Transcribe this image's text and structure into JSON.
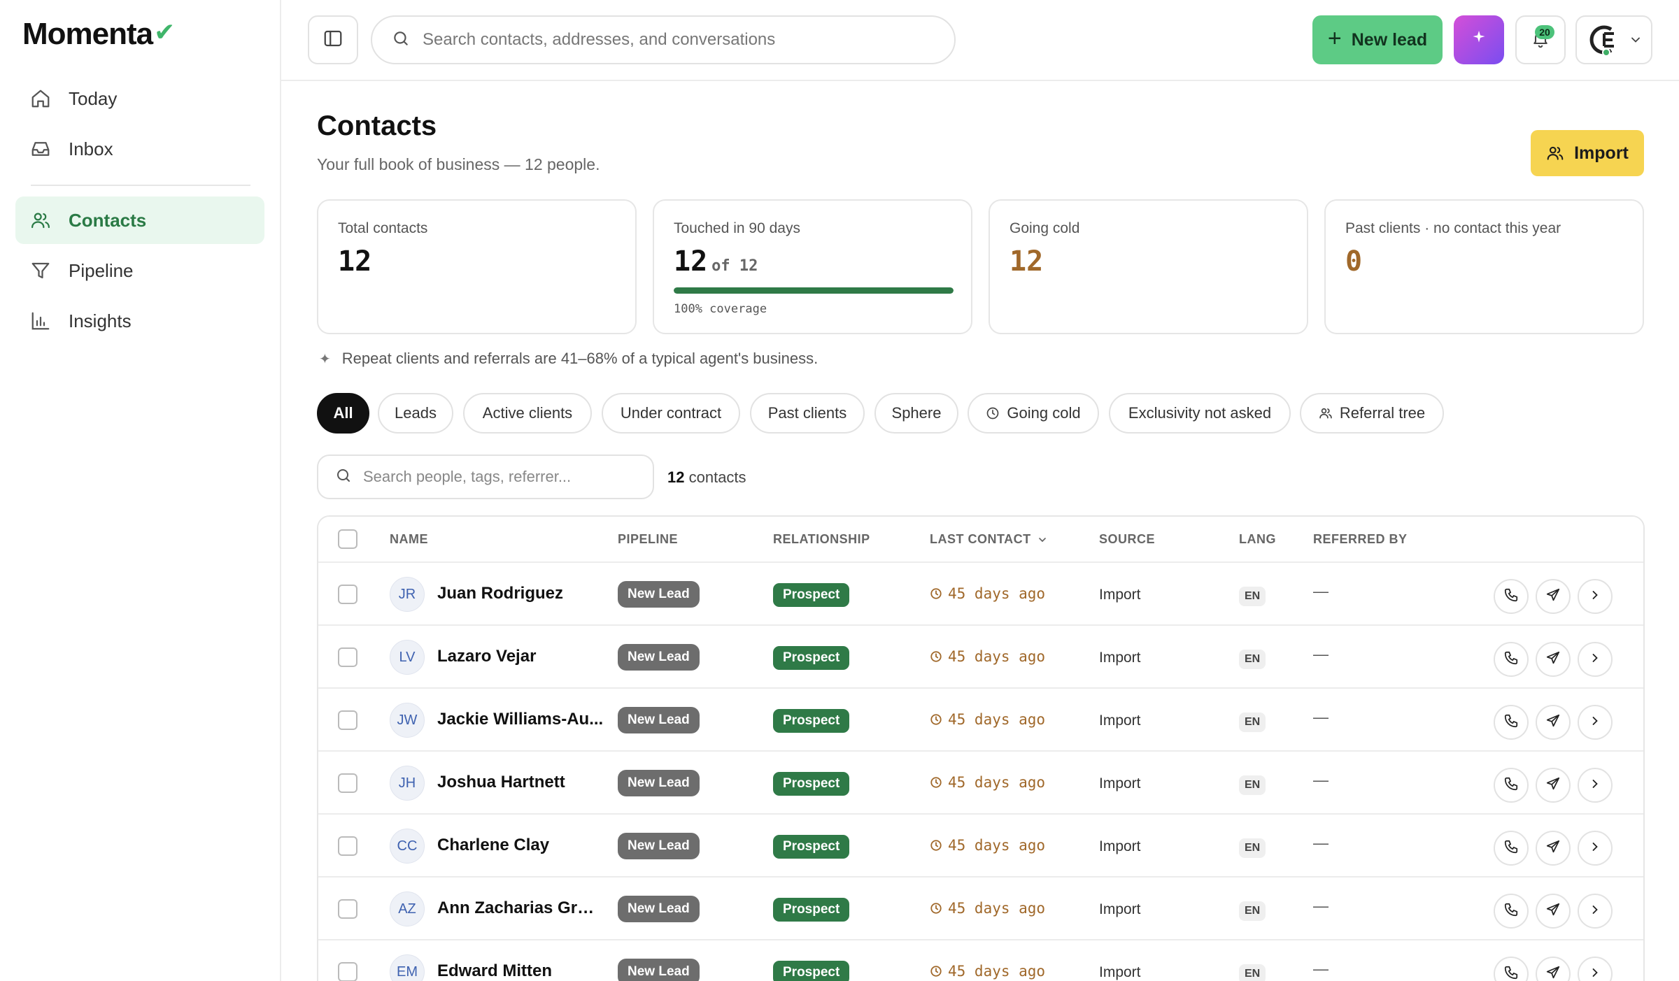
{
  "app": {
    "logo_text": "Momenta",
    "logo_mark": "✔"
  },
  "sidebar": {
    "items": [
      {
        "label": "Today",
        "icon": "home-icon"
      },
      {
        "label": "Inbox",
        "icon": "inbox-icon"
      },
      {
        "label": "Contacts",
        "icon": "users-icon",
        "active": true
      },
      {
        "label": "Pipeline",
        "icon": "filter-icon"
      },
      {
        "label": "Insights",
        "icon": "bar-chart-icon"
      }
    ]
  },
  "topbar": {
    "search_placeholder": "Search contacts, addresses, and conversations",
    "new_lead_label": "New lead",
    "notification_count": "20"
  },
  "page": {
    "title": "Contacts",
    "subtitle": "Your full book of business — 12 people.",
    "import_label": "Import"
  },
  "stats": {
    "total": {
      "label": "Total contacts",
      "value": "12"
    },
    "touched": {
      "label": "Touched in 90 days",
      "value": "12",
      "of_label": "of 12",
      "coverage": "100% coverage",
      "fraction": 1.0
    },
    "cold": {
      "label": "Going cold",
      "value": "12"
    },
    "past": {
      "label": "Past clients · no contact this year",
      "value": "0"
    }
  },
  "tip": "Repeat clients and referrals are 41–68% of a typical agent's business.",
  "filters": [
    {
      "label": "All",
      "active": true
    },
    {
      "label": "Leads"
    },
    {
      "label": "Active clients"
    },
    {
      "label": "Under contract"
    },
    {
      "label": "Past clients"
    },
    {
      "label": "Sphere"
    },
    {
      "label": "Going cold",
      "icon": "clock-icon"
    },
    {
      "label": "Exclusivity not asked"
    },
    {
      "label": "Referral tree",
      "icon": "users-icon"
    }
  ],
  "list": {
    "search_placeholder": "Search people, tags, referrer...",
    "count_number": "12",
    "count_suffix": "contacts"
  },
  "table": {
    "columns": {
      "name": "NAME",
      "pipeline": "PIPELINE",
      "relationship": "RELATIONSHIP",
      "last_contact": "LAST CONTACT",
      "source": "SOURCE",
      "lang": "LANG",
      "referred_by": "REFERRED BY"
    },
    "rows": [
      {
        "initials": "JR",
        "name": "Juan Rodriguez",
        "pipeline": "New Lead",
        "relationship": "Prospect",
        "last_contact": "45 days ago",
        "source": "Import",
        "lang": "EN",
        "referred_by": "—"
      },
      {
        "initials": "LV",
        "name": "Lazaro Vejar",
        "pipeline": "New Lead",
        "relationship": "Prospect",
        "last_contact": "45 days ago",
        "source": "Import",
        "lang": "EN",
        "referred_by": "—"
      },
      {
        "initials": "JW",
        "name": "Jackie Williams-Au...",
        "pipeline": "New Lead",
        "relationship": "Prospect",
        "last_contact": "45 days ago",
        "source": "Import",
        "lang": "EN",
        "referred_by": "—"
      },
      {
        "initials": "JH",
        "name": "Joshua Hartnett",
        "pipeline": "New Lead",
        "relationship": "Prospect",
        "last_contact": "45 days ago",
        "source": "Import",
        "lang": "EN",
        "referred_by": "—"
      },
      {
        "initials": "CC",
        "name": "Charlene Clay",
        "pipeline": "New Lead",
        "relationship": "Prospect",
        "last_contact": "45 days ago",
        "source": "Import",
        "lang": "EN",
        "referred_by": "—"
      },
      {
        "initials": "AZ",
        "name": "Ann Zacharias Gros...",
        "pipeline": "New Lead",
        "relationship": "Prospect",
        "last_contact": "45 days ago",
        "source": "Import",
        "lang": "EN",
        "referred_by": "—"
      },
      {
        "initials": "EM",
        "name": "Edward Mitten",
        "pipeline": "New Lead",
        "relationship": "Prospect",
        "last_contact": "45 days ago",
        "source": "Import",
        "lang": "EN",
        "referred_by": "—"
      }
    ]
  },
  "colors": {
    "accent_green": "#5dcb85",
    "active_nav_bg": "#e9f7ee",
    "relationship_green": "#2f7a47",
    "import_yellow": "#f6d451",
    "warning_brown": "#a0682a"
  }
}
